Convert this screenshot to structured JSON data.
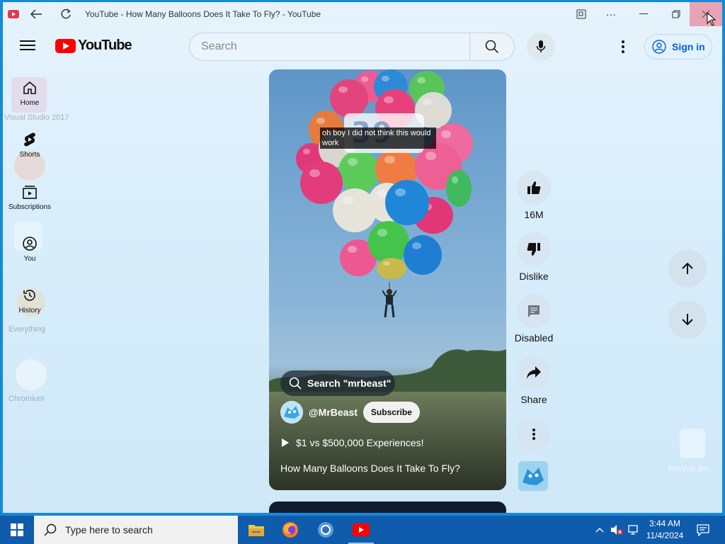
{
  "window": {
    "title": "YouTube - How Many Balloons Does It Take To Fly? - YouTube"
  },
  "header": {
    "logo_text": "YouTube",
    "search_placeholder": "Search",
    "signin_label": "Sign in"
  },
  "sidenav": {
    "items": [
      {
        "label": "Home",
        "icon": "home-icon"
      },
      {
        "label": "Shorts",
        "icon": "shorts-icon"
      },
      {
        "label": "Subscriptions",
        "icon": "subscriptions-icon"
      },
      {
        "label": "You",
        "icon": "you-icon"
      },
      {
        "label": "History",
        "icon": "history-icon"
      }
    ]
  },
  "desktop_ghosts": {
    "items": [
      "Visual Studio 2017",
      "Everything",
      "Chromium",
      "Recycle Bin"
    ]
  },
  "short": {
    "caption": "oh boy I did not think this would work",
    "overlay_number": "39",
    "search_chip": "Search \"mrbeast\"",
    "channel": "@MrBeast",
    "subscribe_label": "Subscribe",
    "related_label": "$1 vs $500,000 Experiences!",
    "title": "How Many Balloons Does It Take To Fly?"
  },
  "actions": {
    "like_count": "16M",
    "dislike_label": "Dislike",
    "comments_label": "Disabled",
    "share_label": "Share"
  },
  "taskbar": {
    "search_placeholder": "Type here to search",
    "time": "3:44 AM",
    "date": "11/4/2024"
  },
  "colors": {
    "brand_red": "#ff0000",
    "link_blue": "#065fd4",
    "taskbar_blue": "#0f5cad"
  }
}
